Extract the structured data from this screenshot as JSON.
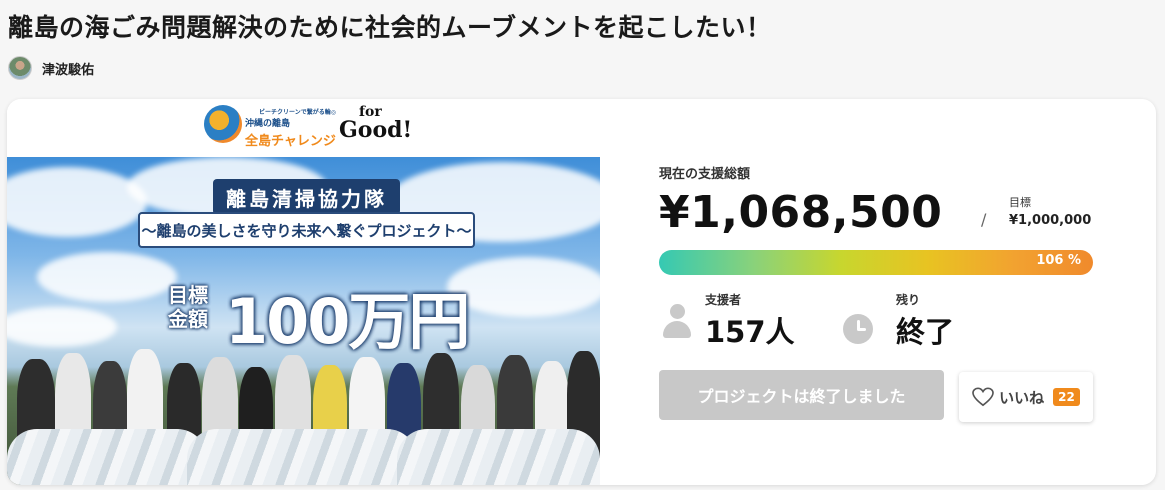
{
  "project": {
    "title": "離島の海ごみ問題解決のために社会的ムーブメントを起こしたい！",
    "owner_name": "津波駿佑"
  },
  "hero": {
    "logo_subtitle": "ビーチクリーンで繋がる輪◎",
    "logo_main": "全島チャレンジ",
    "logo_main_prefix": "沖縄の離島",
    "logo_forgood_top": "for",
    "logo_forgood_bottom": "Good!",
    "banner_tag": "離島清掃協力隊",
    "banner_text": "〜離島の美しさを守り未来へ繋ぐプロジェクト〜",
    "goal_label_1": "目標",
    "goal_label_2": "金額",
    "goal_amount": "100万円"
  },
  "funding": {
    "total_label": "現在の支援総額",
    "total_amount": "¥1,068,500",
    "separator": "/",
    "target_label": "目標",
    "target_amount": "¥1,000,000",
    "progress_percent": 106,
    "progress_text": "106 %"
  },
  "stats": {
    "supporters_label": "支援者",
    "supporters_value": "157人",
    "remaining_label": "残り",
    "remaining_value": "終了"
  },
  "actions": {
    "ended_label": "プロジェクトは終了しました",
    "like_label": "いいね",
    "like_count": "22"
  },
  "colors": {
    "like_badge": "#f08a1c",
    "ended_button": "#c8c8c8",
    "icon_gray": "#c9c9c9"
  },
  "icons": {
    "supporters": "person-icon",
    "remaining": "clock-icon",
    "like": "heart-icon"
  }
}
